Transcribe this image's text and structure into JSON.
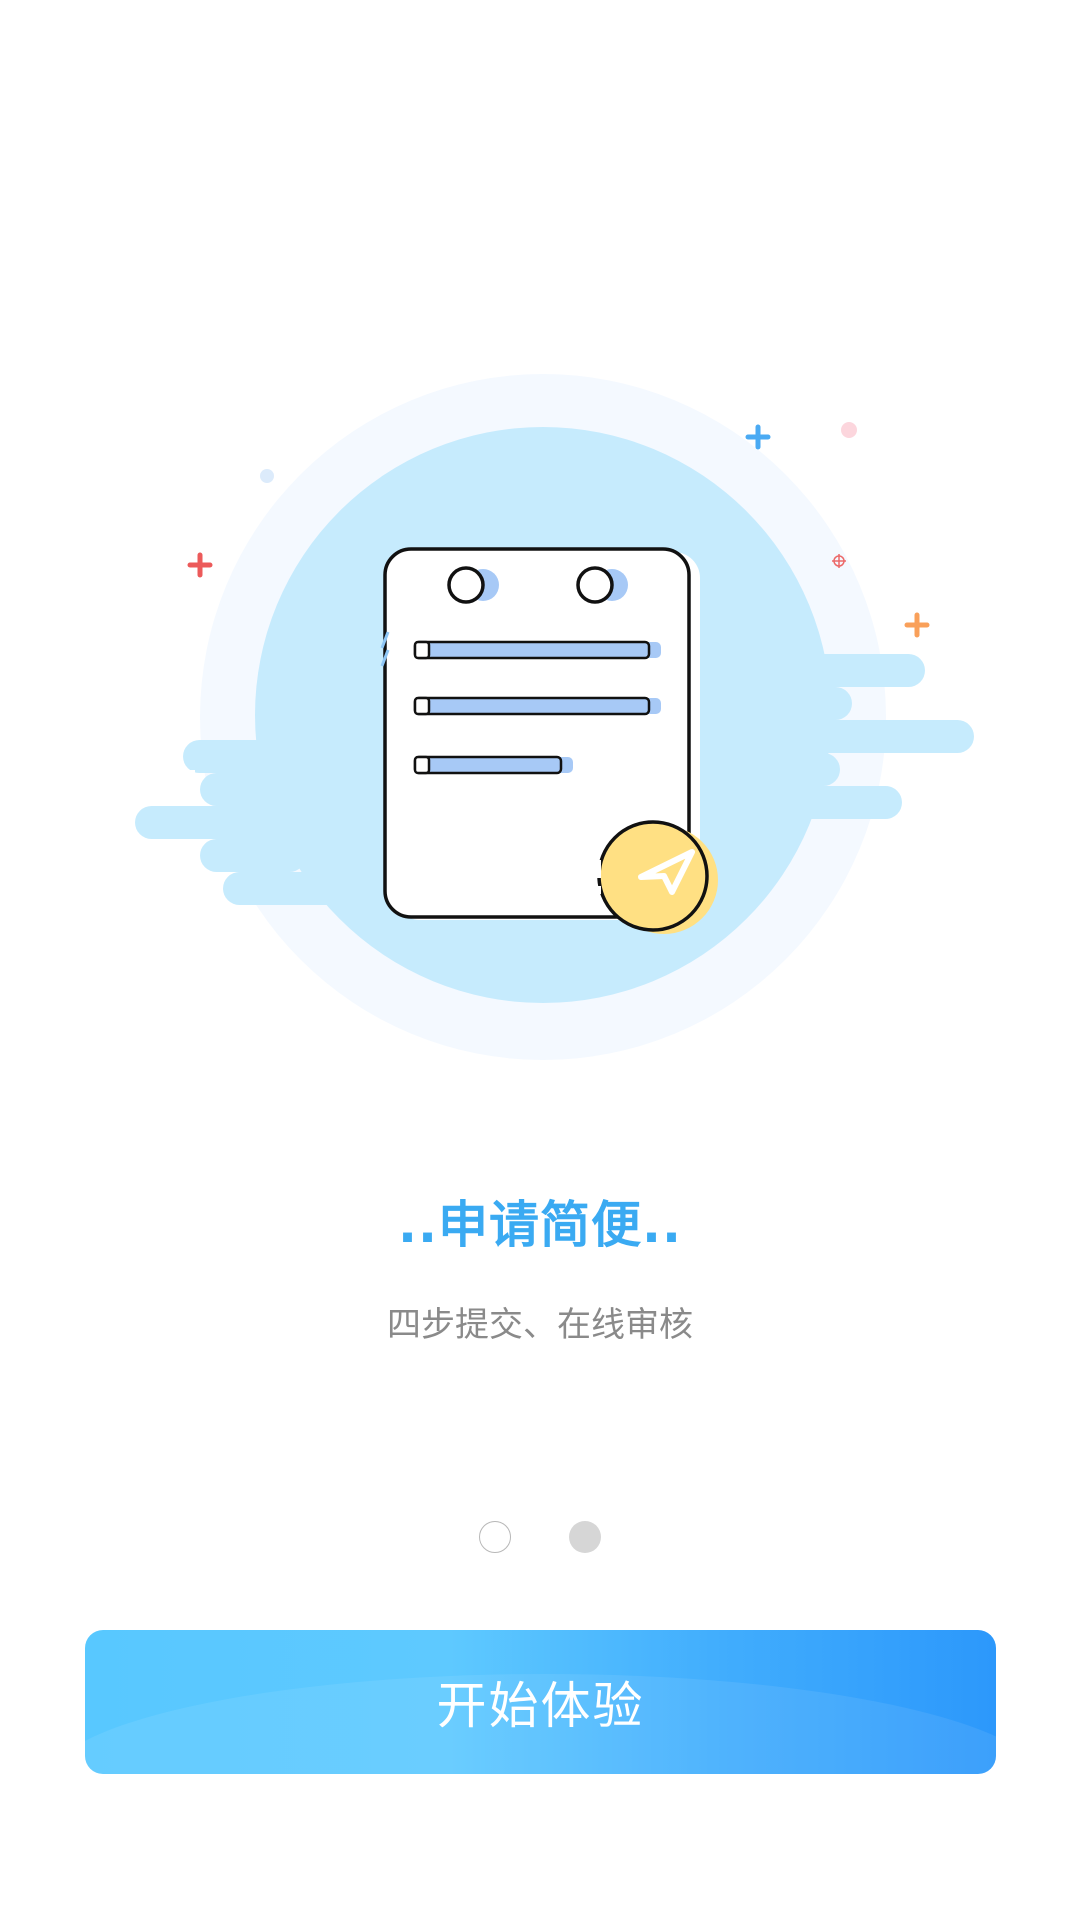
{
  "onboarding": {
    "title": "..申请简便..",
    "subtitle": "四步提交、在线审核",
    "pagination": {
      "total": 2,
      "current_index": 1
    },
    "start_button_label": "开始体验"
  },
  "illustration": {
    "subject": "application-document-with-send-icon"
  },
  "colors": {
    "title": "#3aaaf2",
    "subtitle": "#8a8a8a",
    "button_gradient_start": "#58c8ff",
    "button_gradient_end": "#2c98fb",
    "circle_outer": "#f4f9ff",
    "circle_inner": "#c6ebfd",
    "send_badge": "#ffe083"
  }
}
